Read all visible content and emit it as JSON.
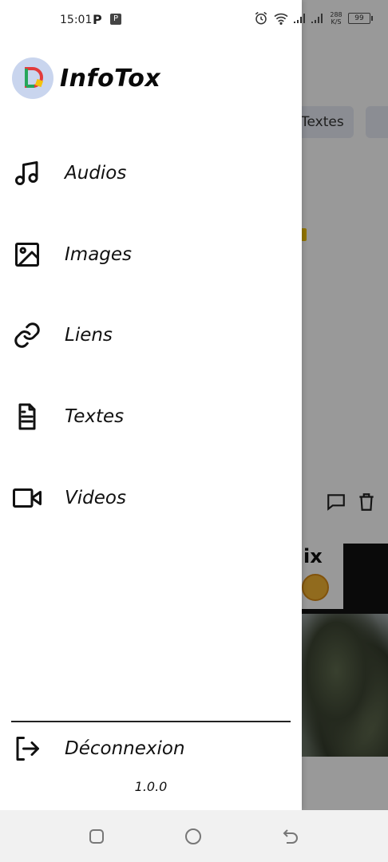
{
  "status_bar": {
    "time": "15:01",
    "app_p": "P",
    "app_ppt": "P",
    "net_speed_value": "288",
    "net_speed_unit": "K/S",
    "battery": "99"
  },
  "drawer": {
    "app_name": "InfoTox",
    "menu": [
      {
        "label": "Audios",
        "icon": "music-note-icon"
      },
      {
        "label": "Images",
        "icon": "image-icon"
      },
      {
        "label": "Liens",
        "icon": "link-icon"
      },
      {
        "label": "Textes",
        "icon": "document-icon"
      },
      {
        "label": "Videos",
        "icon": "video-camera-icon"
      }
    ],
    "logout_label": "Déconnexion",
    "version": "1.0.0"
  },
  "background": {
    "tab_visible": "Textes",
    "card_text": "ix"
  },
  "colors": {
    "logo_bg": "#c9d5ee",
    "logo_red": "#e23b3b",
    "logo_green": "#26a65b",
    "logo_yellow": "#f4c20d",
    "scrim": "rgba(0,0,0,0.4)"
  }
}
